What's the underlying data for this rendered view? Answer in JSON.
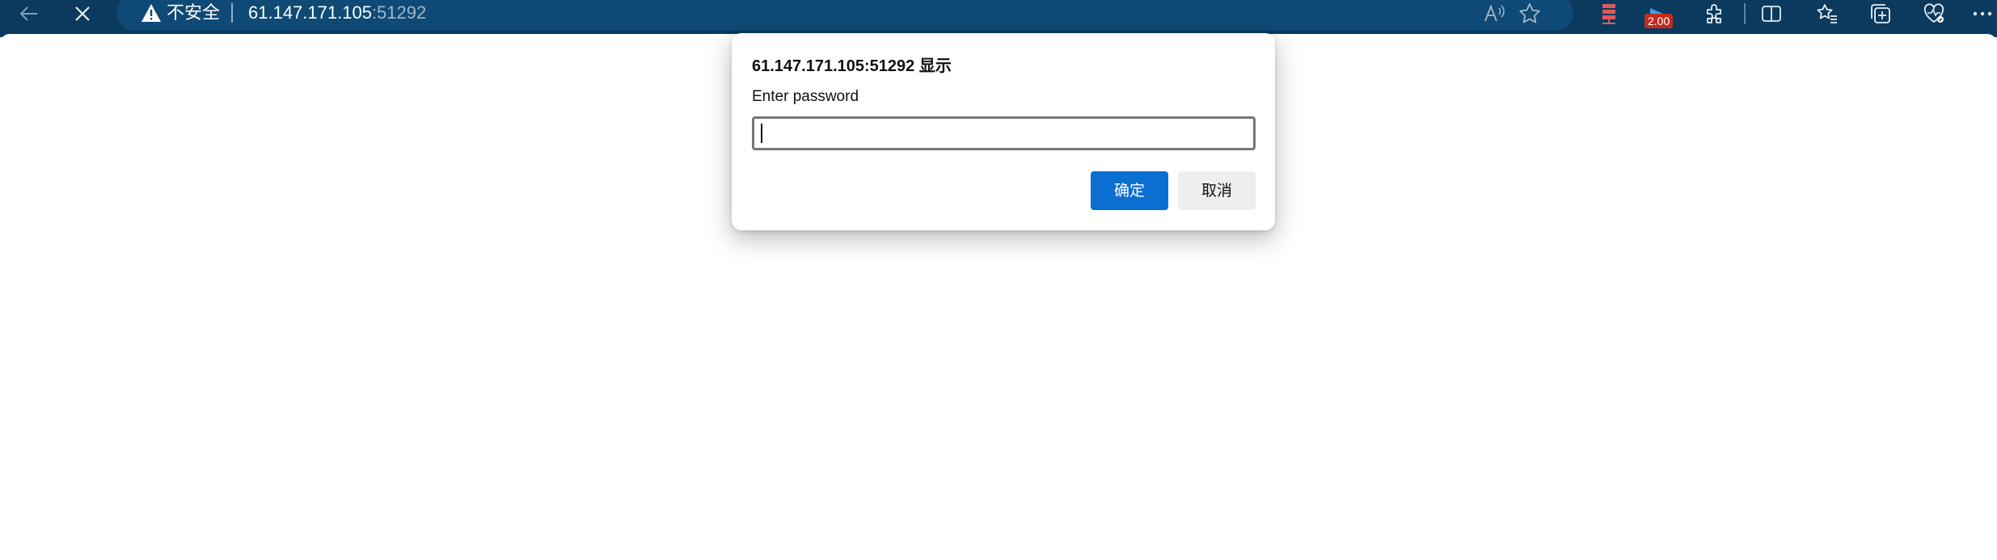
{
  "browser": {
    "security_label": "不安全",
    "url_host": "61.147.171.105",
    "url_port": ":51292",
    "extension_badge": "2.00",
    "icons": [
      "back-icon",
      "close-icon",
      "warning-icon",
      "read-aloud-icon",
      "favorite-star-icon",
      "extension-server-icon",
      "extension-play-icon",
      "extensions-puzzle-icon",
      "split-screen-icon",
      "favorites-icon",
      "collections-icon",
      "browser-essentials-icon",
      "more-icon"
    ]
  },
  "dialog": {
    "title": "61.147.171.105:51292 显示",
    "message": "Enter password",
    "input_value": "",
    "ok_label": "确定",
    "cancel_label": "取消"
  },
  "colors": {
    "toolbar_bg": "#0b3a5e",
    "addressbar_bg": "#0e4a75",
    "ok_button": "#0a6fd1",
    "badge": "#c42b1c"
  }
}
